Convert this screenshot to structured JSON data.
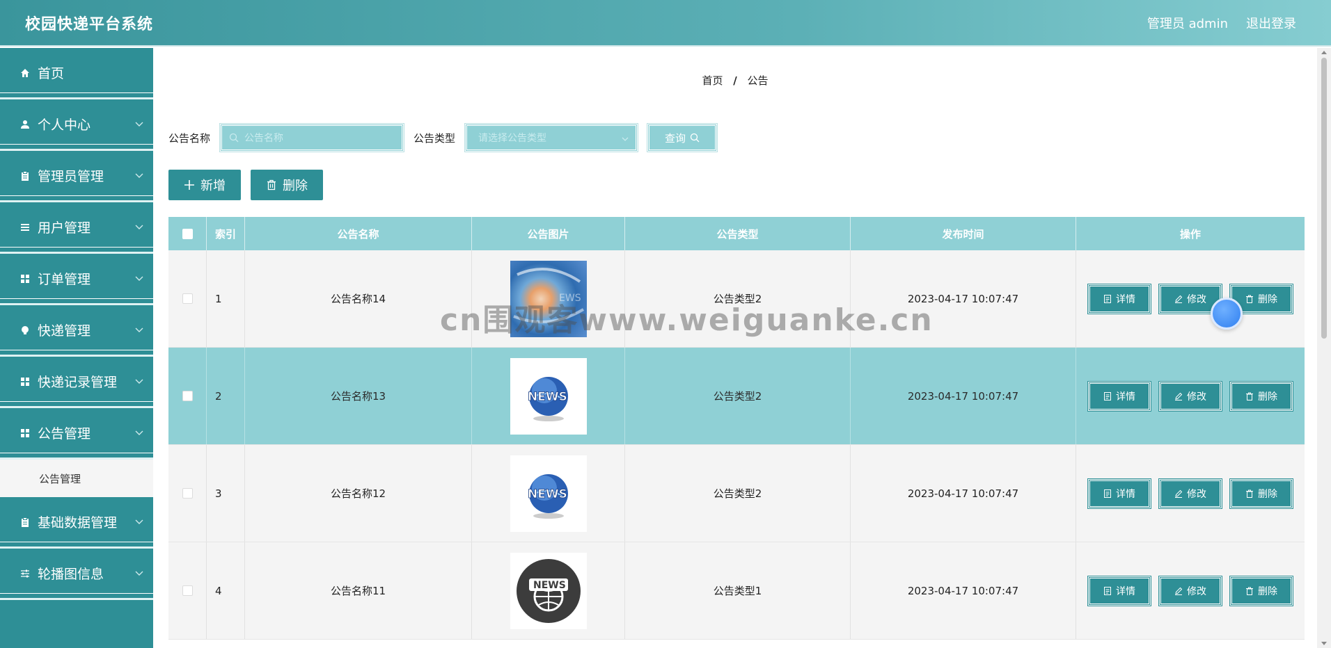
{
  "header": {
    "title": "校园快递平台系统",
    "user_label": "管理员 admin",
    "logout_label": "退出登录"
  },
  "sidebar": {
    "items": [
      {
        "label": "首页",
        "icon": "home-icon",
        "has_chevron": false
      },
      {
        "label": "个人中心",
        "icon": "user-icon",
        "has_chevron": true
      },
      {
        "label": "管理员管理",
        "icon": "clipboard-icon",
        "has_chevron": true
      },
      {
        "label": "用户管理",
        "icon": "list-icon",
        "has_chevron": true
      },
      {
        "label": "订单管理",
        "icon": "grid-icon",
        "has_chevron": true
      },
      {
        "label": "快递管理",
        "icon": "bulb-icon",
        "has_chevron": true
      },
      {
        "label": "快递记录管理",
        "icon": "grid-icon",
        "has_chevron": true
      },
      {
        "label": "公告管理",
        "icon": "grid-icon",
        "has_chevron": true
      }
    ],
    "submenu": {
      "label": "公告管理"
    },
    "items_after": [
      {
        "label": "基础数据管理",
        "icon": "clipboard-icon",
        "has_chevron": true
      },
      {
        "label": "轮播图信息",
        "icon": "sliders-icon",
        "has_chevron": true
      }
    ]
  },
  "breadcrumb": {
    "home": "首页",
    "separator": "/",
    "current": "公告"
  },
  "search": {
    "name_label": "公告名称",
    "name_placeholder": "公告名称",
    "type_label": "公告类型",
    "type_placeholder": "请选择公告类型",
    "query_label": "查询"
  },
  "actions": {
    "add_label": "新增",
    "delete_label": "删除"
  },
  "table": {
    "headers": {
      "index": "索引",
      "name": "公告名称",
      "image": "公告图片",
      "type": "公告类型",
      "time": "发布时间",
      "ops": "操作"
    },
    "rows": [
      {
        "index": "1",
        "name": "公告名称14",
        "image": "news-swirl-photo",
        "type": "公告类型2",
        "time": "2023-04-17 10:07:47"
      },
      {
        "index": "2",
        "name": "公告名称13",
        "image": "news-globe-icon",
        "type": "公告类型2",
        "time": "2023-04-17 10:07:47"
      },
      {
        "index": "3",
        "name": "公告名称12",
        "image": "news-globe-icon",
        "type": "公告类型2",
        "time": "2023-04-17 10:07:47"
      },
      {
        "index": "4",
        "name": "公告名称11",
        "image": "news-dark-globe-icon",
        "type": "公告类型1",
        "time": "2023-04-17 10:07:47"
      }
    ],
    "op_labels": {
      "detail": "详情",
      "edit": "修改",
      "delete": "删除"
    }
  },
  "watermark": "cn围观客www.weiguanke.cn",
  "colors": {
    "primary": "#2e8f96",
    "accent_light": "#8fd0d5",
    "header_gradient_end": "#86cdd1"
  }
}
